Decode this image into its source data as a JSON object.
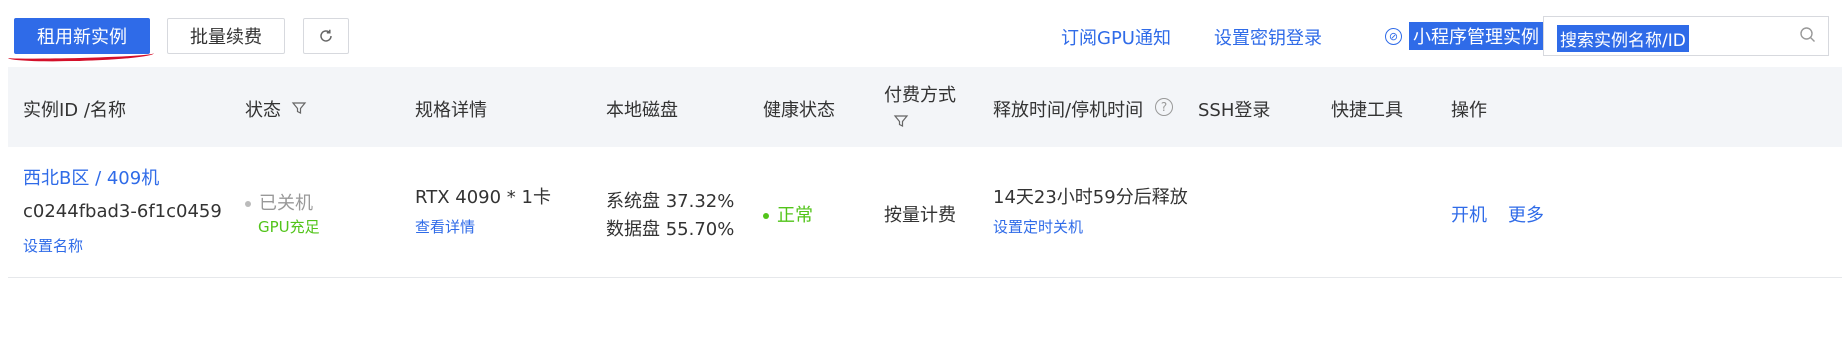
{
  "toolbar": {
    "rent_button": "租用新实例",
    "batch_renew_button": "批量续费",
    "refresh_icon": "refresh-icon",
    "subscribe_gpu_link": "订阅GPU通知",
    "ssh_key_link": "设置密钥登录",
    "mini_program_link": "小程序管理实例",
    "search_placeholder": "搜索实例名称/ID"
  },
  "table": {
    "headers": {
      "instance": "实例ID /名称",
      "status": "状态",
      "spec": "规格详情",
      "disk": "本地磁盘",
      "health": "健康状态",
      "payment_line1": "付费方式",
      "release": "释放时间/停机时间",
      "ssh": "SSH登录",
      "tools": "快捷工具",
      "actions": "操作"
    },
    "rows": [
      {
        "region_name": "西北B区 / 409机",
        "instance_id": "c0244fbad3-6f1c0459",
        "set_name": "设置名称",
        "status": "已关机",
        "gpu_status": "GPU充足",
        "spec": "RTX 4090 * 1卡",
        "spec_link": "查看详情",
        "system_disk": "系统盘 37.32%",
        "data_disk": "数据盘 55.70%",
        "health": "正常",
        "payment": "按量计费",
        "release_time": "14天23小时59分后释放",
        "schedule_shutdown": "设置定时关机",
        "action_start": "开机",
        "action_more": "更多"
      }
    ]
  },
  "colors": {
    "accent": "#2f6be8",
    "success": "#52c41a",
    "header_bg": "#f3f5f8",
    "annotation_red": "#d4102a"
  }
}
